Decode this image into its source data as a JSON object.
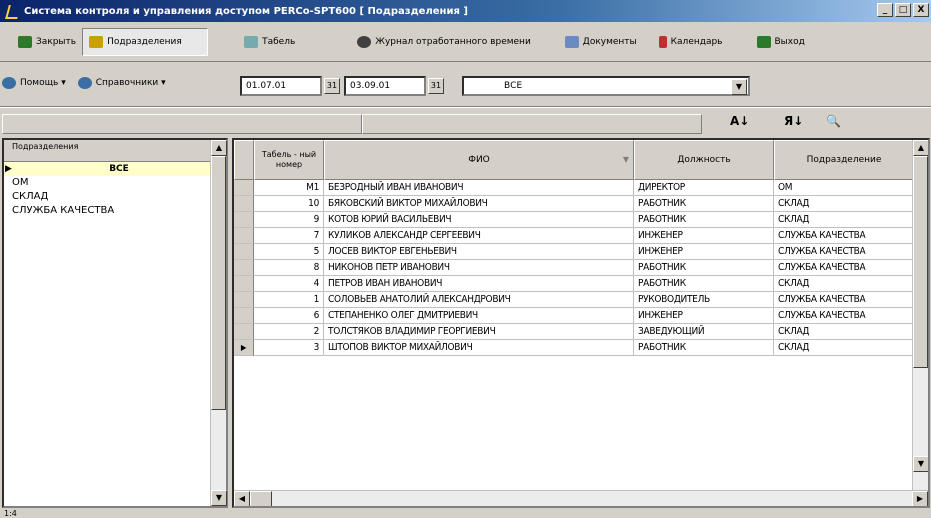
{
  "window": {
    "title": "Система контроля и управления доступом PERCo-SPT600 [ Подразделения ]",
    "btn_min": "_",
    "btn_max": "□",
    "btn_close": "X"
  },
  "toolbar": {
    "close": "Закрыть",
    "departments": "Подразделения",
    "timesheet": "Табель",
    "worklog": "Журнал отработанного времени",
    "documents": "Документы",
    "calendar": "Календарь",
    "exit": "Выход",
    "help": "Помощь ▾",
    "reference": "Справочники ▾"
  },
  "filter": {
    "date_from": "01.07.01",
    "date_to": "03.09.01",
    "department": "ВСЕ",
    "cal": "31"
  },
  "sort": {
    "asc": "А↓",
    "desc": "Я↓",
    "find": "🔍"
  },
  "left": {
    "header": "Подразделения",
    "items": [
      "ВСЕ",
      "ОМ",
      "СКЛАД",
      "СЛУЖБА КАЧЕСТВА"
    ]
  },
  "grid": {
    "headers": [
      "Табель - ный номер",
      "ФИО",
      "Должность",
      "Подразделение"
    ],
    "rows": [
      [
        "М1",
        "БЕЗРОДНЫЙ ИВАН ИВАНОВИЧ",
        "ДИРЕКТОР",
        "ОМ"
      ],
      [
        "10",
        "БЯКОВСКИЙ ВИКТОР МИХАЙЛОВИЧ",
        "РАБОТНИК",
        "СКЛАД"
      ],
      [
        "9",
        "КОТОВ ЮРИЙ ВАСИЛЬЕВИЧ",
        "РАБОТНИК",
        "СКЛАД"
      ],
      [
        "7",
        "КУЛИКОВ АЛЕКСАНДР СЕРГЕЕВИЧ",
        "ИНЖЕНЕР",
        "СЛУЖБА КАЧЕСТВА"
      ],
      [
        "5",
        "ЛОСЕВ ВИКТОР ЕВГЕНЬЕВИЧ",
        "ИНЖЕНЕР",
        "СЛУЖБА КАЧЕСТВА"
      ],
      [
        "8",
        "НИКОНОВ ПЕТР ИВАНОВИЧ",
        "РАБОТНИК",
        "СЛУЖБА КАЧЕСТВА"
      ],
      [
        "4",
        "ПЕТРОВ ИВАН ИВАНОВИЧ",
        "РАБОТНИК",
        "СКЛАД"
      ],
      [
        "1",
        "СОЛОВЬЕВ АНАТОЛИЙ АЛЕКСАНДРОВИЧ",
        "РУКОВОДИТЕЛЬ",
        "СЛУЖБА КАЧЕСТВА"
      ],
      [
        "6",
        "СТЕПАНЕНКО ОЛЕГ ДМИТРИЕВИЧ",
        "ИНЖЕНЕР",
        "СЛУЖБА КАЧЕСТВА"
      ],
      [
        "2",
        "ТОЛСТЯКОВ ВЛАДИМИР ГЕОРГИЕВИЧ",
        "ЗАВЕДУЮЩИЙ",
        "СКЛАД"
      ],
      [
        "3",
        "ШТОПОВ ВИКТОР МИХАЙЛОВИЧ",
        "РАБОТНИК",
        "СКЛАД"
      ]
    ]
  },
  "status": "1:4"
}
